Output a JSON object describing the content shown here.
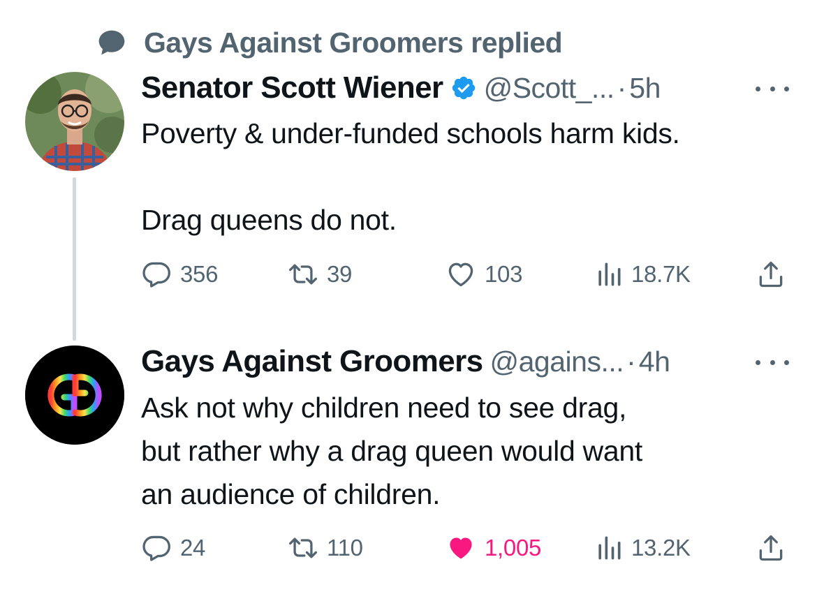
{
  "context": {
    "text": "Gays Against Groomers replied",
    "icon": "speech-bubble-icon"
  },
  "tweets": [
    {
      "display_name": "Senator Scott Wiener",
      "verified": true,
      "handle": "@Scott_...",
      "separator": "·",
      "time": "5h",
      "lines": [
        "Poverty & under-funded schools harm kids.",
        "",
        "Drag queens do not."
      ],
      "replies": "356",
      "retweets": "39",
      "likes": "103",
      "views": "18.7K",
      "liked": false
    },
    {
      "display_name": "Gays Against Groomers",
      "verified": false,
      "handle": "@agains...",
      "separator": "·",
      "time": "4h",
      "lines": [
        "Ask not why children need to see drag,",
        "but rather why a drag queen would want",
        "an audience of children."
      ],
      "replies": "24",
      "retweets": "110",
      "likes": "1,005",
      "views": "13.2K",
      "liked": true
    }
  ],
  "colors": {
    "text_primary": "#0f1419",
    "text_secondary": "#536471",
    "verified_blue": "#1d9bf0",
    "like_pink": "#f91880",
    "thread_line": "#cfd9de"
  }
}
